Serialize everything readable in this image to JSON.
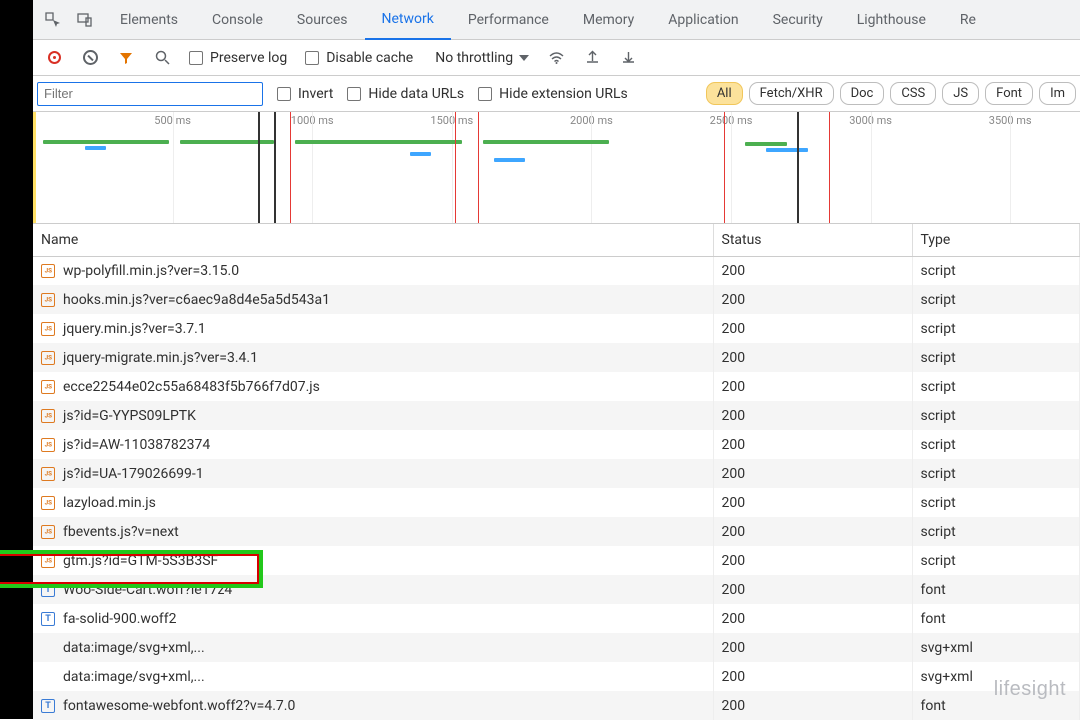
{
  "tabs": [
    "Elements",
    "Console",
    "Sources",
    "Network",
    "Performance",
    "Memory",
    "Application",
    "Security",
    "Lighthouse",
    "Re"
  ],
  "active_tab": "Network",
  "toolbar": {
    "preserve_log": "Preserve log",
    "disable_cache": "Disable cache",
    "throttling": "No throttling"
  },
  "filterbar": {
    "filter_placeholder": "Filter",
    "invert": "Invert",
    "hide_data_urls": "Hide data URLs",
    "hide_ext_urls": "Hide extension URLs",
    "pills": [
      "All",
      "Fetch/XHR",
      "Doc",
      "CSS",
      "JS",
      "Font",
      "Im"
    ],
    "active_pill": "All"
  },
  "waterfall": {
    "ticks": [
      "500 ms",
      "1000 ms",
      "1500 ms",
      "2000 ms",
      "2500 ms",
      "3000 ms",
      "3500 ms"
    ]
  },
  "columns": {
    "name": "Name",
    "status": "Status",
    "type": "Type"
  },
  "rows": [
    {
      "icon": "js",
      "name": "wp-polyfill.min.js?ver=3.15.0",
      "status": "200",
      "type": "script"
    },
    {
      "icon": "js",
      "name": "hooks.min.js?ver=c6aec9a8d4e5a5d543a1",
      "status": "200",
      "type": "script"
    },
    {
      "icon": "js",
      "name": "jquery.min.js?ver=3.7.1",
      "status": "200",
      "type": "script"
    },
    {
      "icon": "js",
      "name": "jquery-migrate.min.js?ver=3.4.1",
      "status": "200",
      "type": "script"
    },
    {
      "icon": "js",
      "name": "ecce22544e02c55a68483f5b766f7d07.js",
      "status": "200",
      "type": "script"
    },
    {
      "icon": "js",
      "name": "js?id=G-YYPS09LPTK",
      "status": "200",
      "type": "script"
    },
    {
      "icon": "js",
      "name": "js?id=AW-11038782374",
      "status": "200",
      "type": "script"
    },
    {
      "icon": "js",
      "name": "js?id=UA-179026699-1",
      "status": "200",
      "type": "script"
    },
    {
      "icon": "js",
      "name": "lazyload.min.js",
      "status": "200",
      "type": "script"
    },
    {
      "icon": "js",
      "name": "fbevents.js?v=next",
      "status": "200",
      "type": "script"
    },
    {
      "icon": "js",
      "name": "gtm.js?id=GTM-5S3B3SF",
      "status": "200",
      "type": "script",
      "highlight": true
    },
    {
      "icon": "font",
      "name": "Woo-Side-Cart.woff?le17z4",
      "status": "200",
      "type": "font"
    },
    {
      "icon": "font",
      "name": "fa-solid-900.woff2",
      "status": "200",
      "type": "font"
    },
    {
      "icon": "",
      "name": "data:image/svg+xml,...",
      "status": "200",
      "type": "svg+xml"
    },
    {
      "icon": "",
      "name": "data:image/svg+xml,...",
      "status": "200",
      "type": "svg+xml"
    },
    {
      "icon": "font",
      "name": "fontawesome-webfont.woff2?v=4.7.0",
      "status": "200",
      "type": "font"
    }
  ],
  "watermark": "lifesight"
}
